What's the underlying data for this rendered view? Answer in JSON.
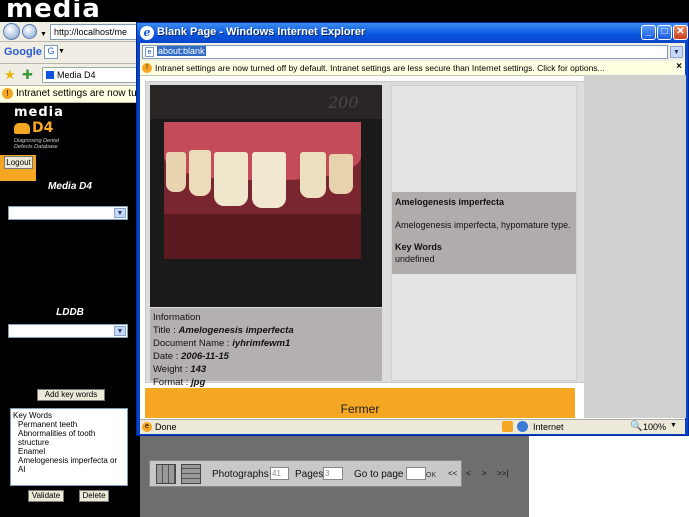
{
  "background_browser": {
    "logo": "media",
    "address": "http://localhost/me",
    "google_label": "Google",
    "fav_tab": "Media D4",
    "infobar": "Intranet settings are now turned off"
  },
  "sidebar": {
    "logo_top": "media",
    "logo_d4": "D4",
    "logo_sub1": "Diagnosing Dental",
    "logo_sub2": "Defects Database",
    "logout": "Logout",
    "section1": "Media D4",
    "section2": "LDDB",
    "add_key_words": "Add key words",
    "keywords": [
      "Key Words",
      "Permanent teeth",
      "Abnormalities of tooth structure",
      "Enamel",
      "Amelogenesis imperfecta or AI"
    ],
    "validate": "Validate",
    "delete": "Delete"
  },
  "bottom_toolbar": {
    "photographs_label": "Photographs",
    "photographs_value": "41",
    "pages_label": "Pages",
    "pages_value": "3",
    "goto_label": "Go to page",
    "ok": "OK",
    "first": "<<",
    "prev": "<",
    "next": ">",
    "last": ">>|"
  },
  "popup": {
    "title": "Blank Page - Windows Internet Explorer",
    "address": "about:blank",
    "infobar": "Intranet settings are now turned off by default. Intranet settings are less secure than Internet settings. Click for options...",
    "photo_label": "200",
    "info": {
      "heading": "Information",
      "title_label": "Title :",
      "title_value": "Amelogenesis imperfecta",
      "docname_label": "Document Name :",
      "docname_value": "iyhrimfewm1",
      "date_label": "Date :",
      "date_value": "2006-11-15",
      "weight_label": "Weight :",
      "weight_value": "143",
      "format_label": "Format :",
      "format_value": "jpg"
    },
    "description": {
      "heading": "Amelogenesis imperfecta",
      "text": "Amelogenesis imperfecta, hypomature type.",
      "keywords_heading": "Key Words",
      "keywords_value": "undefined"
    },
    "close_button": "Fermer",
    "status": {
      "done": "Done",
      "zone": "Internet",
      "zoom": "100%"
    }
  },
  "colors": {
    "accent": "#f5a623",
    "title_blue": "#0a54df",
    "panel_gray": "#b4b0b0"
  }
}
